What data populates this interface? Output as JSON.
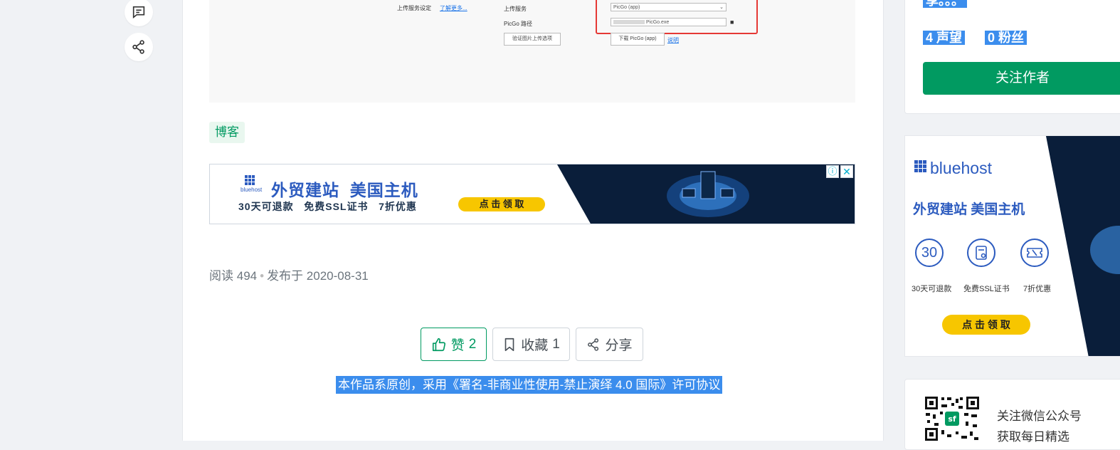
{
  "floating_actions": {
    "comment_icon": "comment-icon",
    "share_icon": "share-icon"
  },
  "screenshot": {
    "upload_setting_label": "上传服务设定",
    "learn_more_link": "了解更多...",
    "upload_service_label": "上传服务",
    "upload_service_value": "PicGo (app)",
    "picgo_path_label": "PicGo 路径",
    "picgo_path_value": "PicGo.exe",
    "verify_button": "验证图片上传选项",
    "download_button": "下载 PicGo (app)",
    "help_link": "说明"
  },
  "article": {
    "tag": "博客",
    "read_label": "阅读",
    "read_count": "494",
    "published_label": "发布于",
    "published_date": "2020-08-31",
    "like_label": "赞",
    "like_count": "2",
    "collect_label": "收藏",
    "collect_count": "1",
    "share_label": "分享",
    "license_text": "本作品系原创，采用《署名-非商业性使用-禁止演绎 4.0 国际》许可协议"
  },
  "ad_banner": {
    "brand": "bluehost",
    "headline": "外贸建站  美国主机",
    "subline": "30天可退款   免费SSL证书   7折优惠",
    "cta": "点 击 领 取"
  },
  "author_card": {
    "bio_snippet": "享。。。",
    "reputation_value": "4",
    "reputation_label": "声望",
    "followers_value": "0",
    "followers_label": "粉丝",
    "follow_button": "关注作者"
  },
  "side_ad": {
    "brand": "bluehost",
    "headline": "外贸建站 美国主机",
    "features": [
      {
        "icon": "30",
        "label": "30天可退款"
      },
      {
        "icon": "ssl-certificate-icon",
        "label": "免费SSL证书"
      },
      {
        "icon": "discount-ticket-icon",
        "label": "7折优惠"
      }
    ],
    "cta": "点 击 领 取"
  },
  "wechat_card": {
    "line1": "关注微信公众号",
    "line2": "获取每日精选"
  },
  "colors": {
    "accent": "#009a61",
    "highlight": "#3b8ded",
    "ad_dark": "#0a1e3a",
    "ad_yellow": "#f7c600"
  }
}
